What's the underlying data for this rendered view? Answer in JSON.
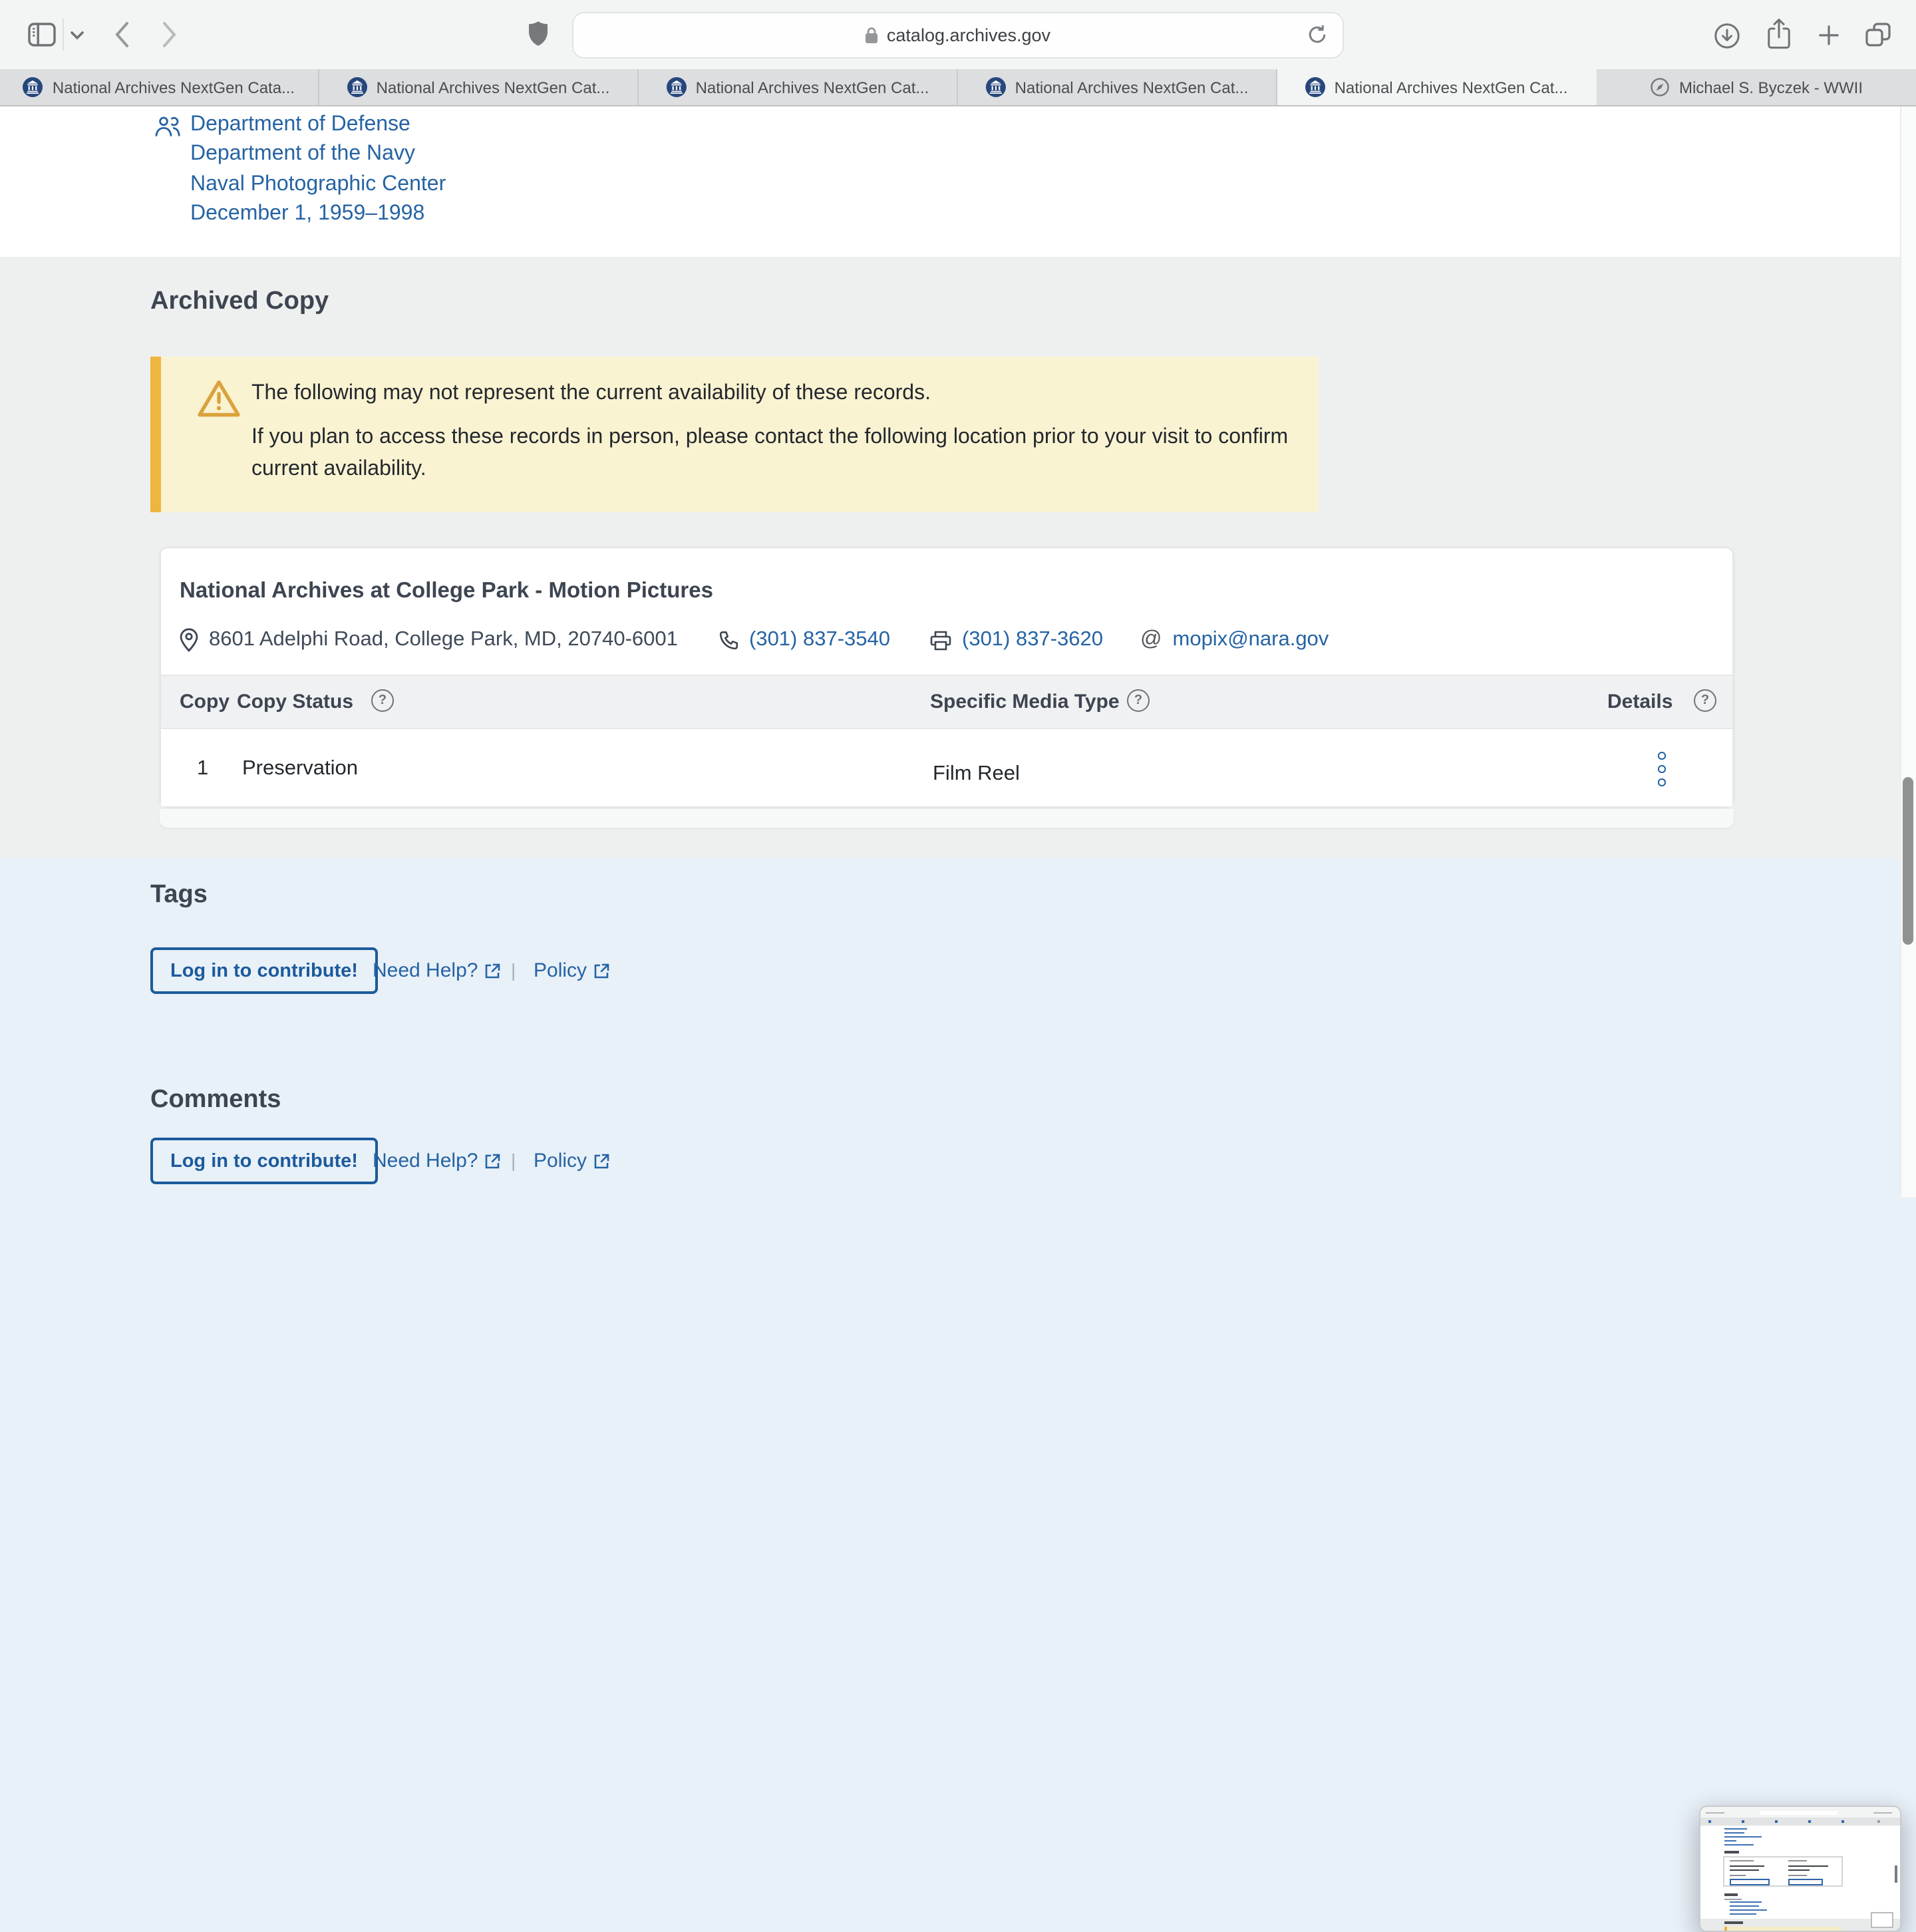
{
  "browser": {
    "url": "catalog.archives.gov",
    "tabs": [
      {
        "label": "National Archives NextGen Cata...",
        "icon": "archives-favicon"
      },
      {
        "label": "National Archives NextGen Cat...",
        "icon": "archives-favicon"
      },
      {
        "label": "National Archives NextGen Cat...",
        "icon": "archives-favicon"
      },
      {
        "label": "National Archives NextGen Cat...",
        "icon": "archives-favicon"
      },
      {
        "label": "National Archives NextGen Cat...",
        "icon": "archives-favicon"
      },
      {
        "label": "Michael S. Byczek - WWII",
        "icon": "compass-favicon"
      }
    ]
  },
  "creator": {
    "links": [
      "Department of Defense",
      "Department of the Navy",
      "Naval Photographic Center",
      "December 1, 1959–1998"
    ]
  },
  "archived_copy": {
    "heading": "Archived Copy",
    "alert_line1": "The following may not represent the current availability of these records.",
    "alert_line2": "If you plan to access these records in person, please contact the following location prior to your visit to confirm current availability.",
    "location_name": "National Archives at College Park - Motion Pictures",
    "address": "8601 Adelphi Road, College Park, MD, 20740-6001",
    "phone": "(301) 837-3540",
    "fax": "(301) 837-3620",
    "email": "mopix@nara.gov",
    "table": {
      "col_copy": "Copy",
      "col_status": "Copy Status",
      "col_media": "Specific Media Type",
      "col_details": "Details",
      "row_copy": "1",
      "row_status": "Preservation",
      "row_media": "Film Reel"
    }
  },
  "tags": {
    "heading": "Tags",
    "login_button": "Log in to contribute!",
    "need_help": "Need Help?",
    "policy": "Policy"
  },
  "comments": {
    "heading": "Comments",
    "login_button": "Log in to contribute!",
    "need_help": "Need Help?",
    "policy": "Policy"
  },
  "glyphs": {
    "help": "?",
    "at": "@",
    "divider": "|"
  },
  "colors": {
    "link_blue": "#2563a3",
    "button_blue": "#1c5a9c",
    "heading": "#3d4551",
    "alert_bg": "#faf3d2",
    "alert_border": "#eeb63e",
    "section_gray": "#eef0f0",
    "section_blue": "#e8f0f8",
    "favicon_navy": "#27477c"
  }
}
